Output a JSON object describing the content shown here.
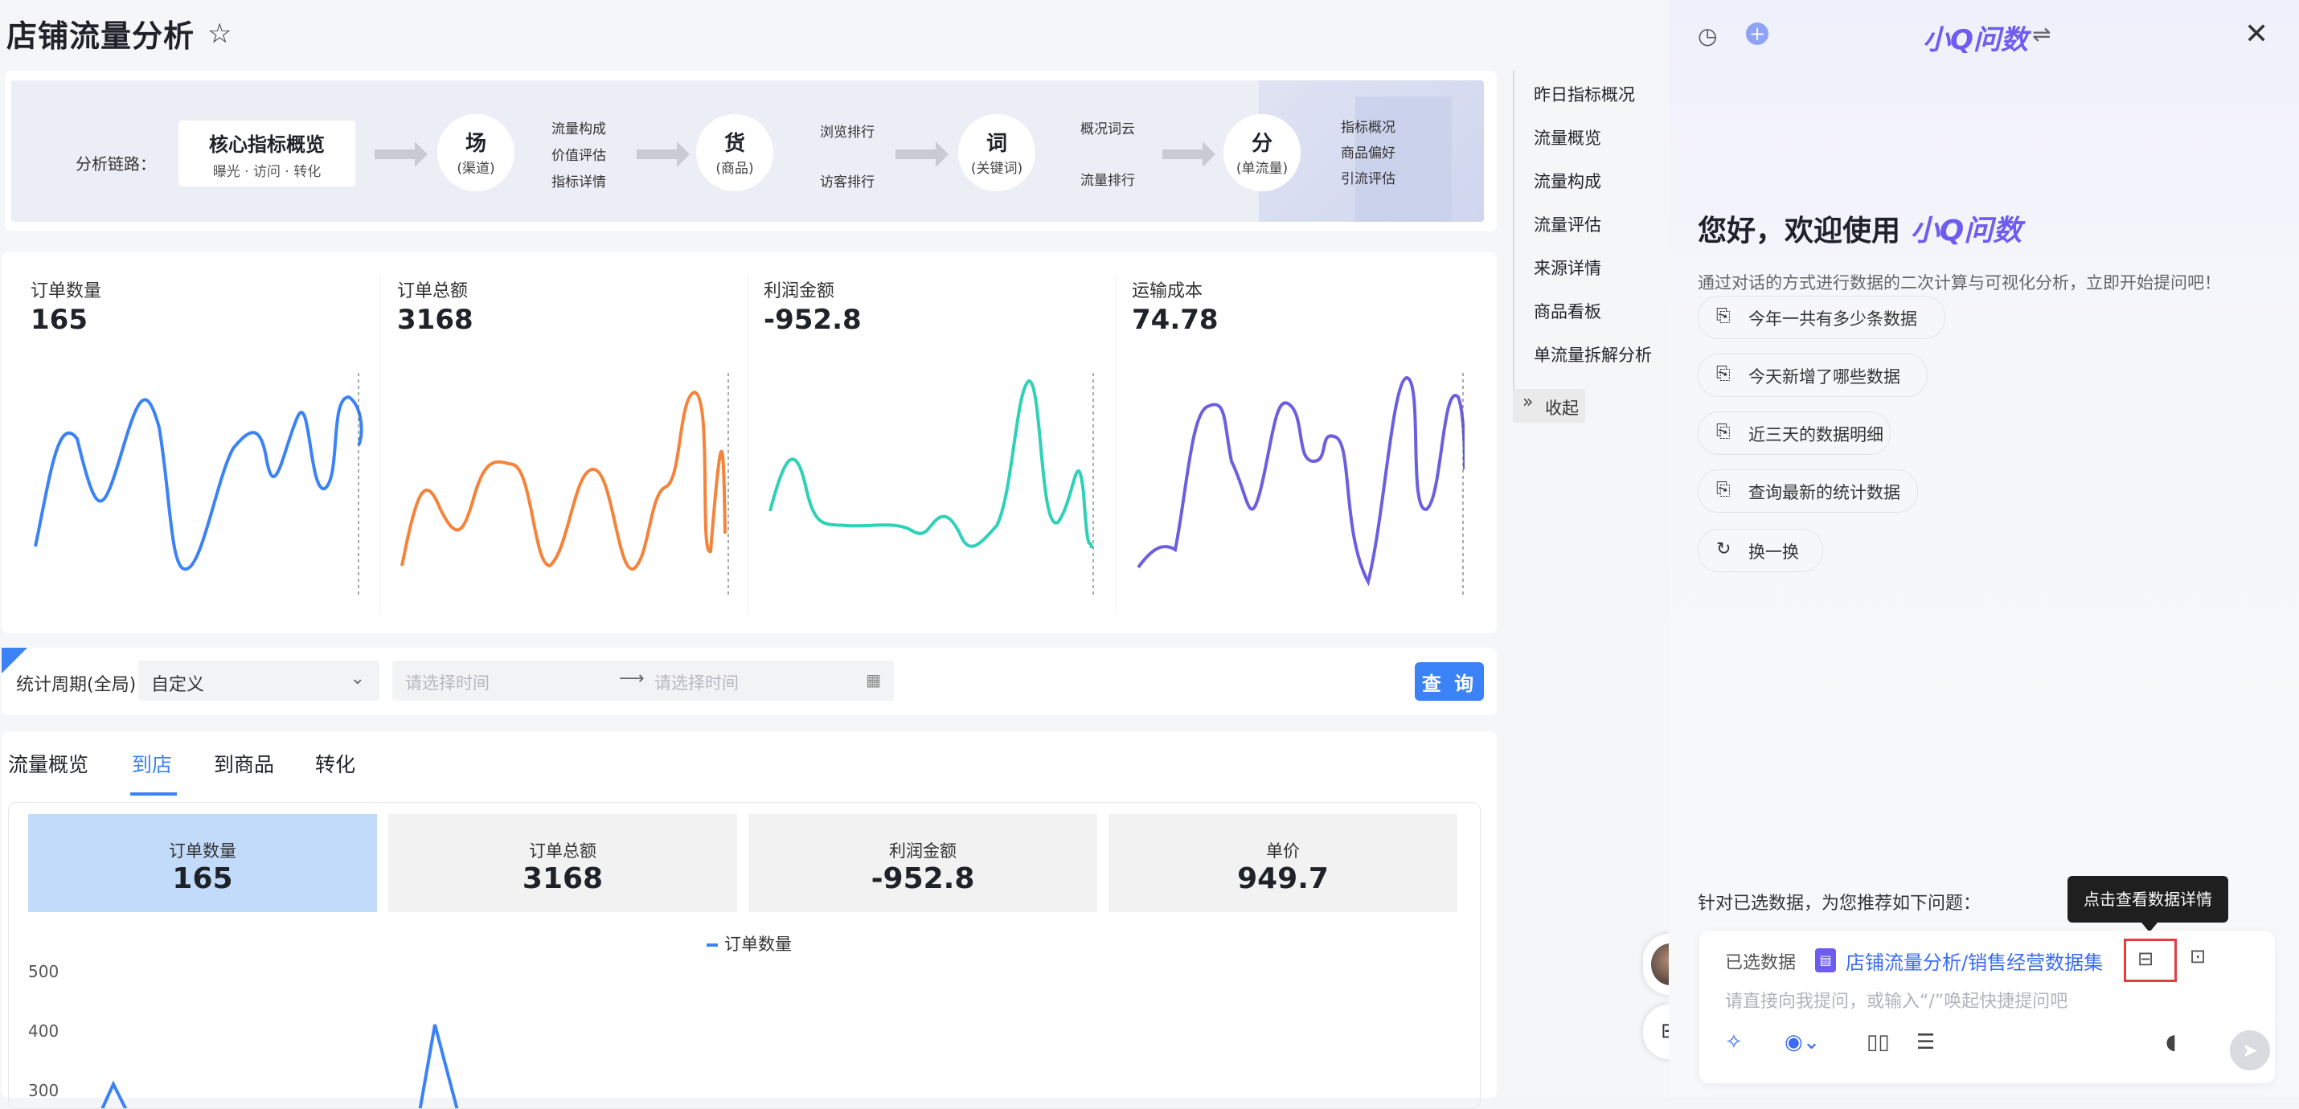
{
  "page": {
    "title": "店铺流量分析",
    "star_icon": "star-icon"
  },
  "flow": {
    "label": "分析链路：",
    "core": {
      "title": "核心指标概览",
      "sub": "曝光 · 访问 · 转化"
    },
    "nodes": [
      {
        "title": "场",
        "sub": "(渠道)",
        "items": [
          "流量构成",
          "价值评估",
          "指标详情"
        ]
      },
      {
        "title": "货",
        "sub": "(商品)",
        "items": [
          "浏览排行",
          "访客排行"
        ]
      },
      {
        "title": "词",
        "sub": "(关键词)",
        "items": [
          "概况词云",
          "流量排行"
        ]
      },
      {
        "title": "分",
        "sub": "(单流量)",
        "items": [
          "指标概况",
          "商品偏好",
          "引流评估"
        ]
      }
    ]
  },
  "kpis": [
    {
      "label": "订单数量",
      "value": "165",
      "color": "#3b82f6"
    },
    {
      "label": "订单总额",
      "value": "3168",
      "color": "#f5833a"
    },
    {
      "label": "利润金额",
      "value": "-952.8",
      "color": "#2ed1b8"
    },
    {
      "label": "运输成本",
      "value": "74.78",
      "color": "#6b5fe0"
    }
  ],
  "filter": {
    "label": "统计周期(全局)",
    "mode": "自定义",
    "start_placeholder": "请选择时间",
    "end_placeholder": "请选择时间",
    "query_label": "查 询"
  },
  "tabs": [
    "流量概览",
    "到店",
    "到商品",
    "转化"
  ],
  "active_tab": "到店",
  "metrics": [
    {
      "label": "订单数量",
      "value": "165"
    },
    {
      "label": "订单总额",
      "value": "3168"
    },
    {
      "label": "利润金额",
      "value": "-952.8"
    },
    {
      "label": "单价",
      "value": "949.7"
    }
  ],
  "chart_data": {
    "type": "line",
    "legend": [
      "订单数量"
    ],
    "y_ticks": [
      "500",
      "400",
      "300"
    ]
  },
  "rnav": {
    "items": [
      "昨日指标概况",
      "流量概览",
      "流量构成",
      "流量评估",
      "来源详情",
      "商品看板",
      "单流量拆解分析"
    ],
    "collapse": "收起"
  },
  "assistant": {
    "brand": "小Q问数",
    "welcome": "您好，欢迎使用",
    "desc": "通过对话的方式进行数据的二次计算与可视化分析，立即开始提问吧！",
    "suggestions": [
      "今年一共有多少条数据",
      "今天新增了哪些数据",
      "近三天的数据明细",
      "查询最新的统计数据"
    ],
    "refresh": "换一换",
    "recommend": "针对已选数据，为您推荐如下问题：",
    "tooltip": "点击查看数据详情",
    "selected_label": "已选数据",
    "dataset": "店铺流量分析/销售经营数据集",
    "input_placeholder": "请直接向我提问，或输入“/”唤起快捷提问吧"
  }
}
